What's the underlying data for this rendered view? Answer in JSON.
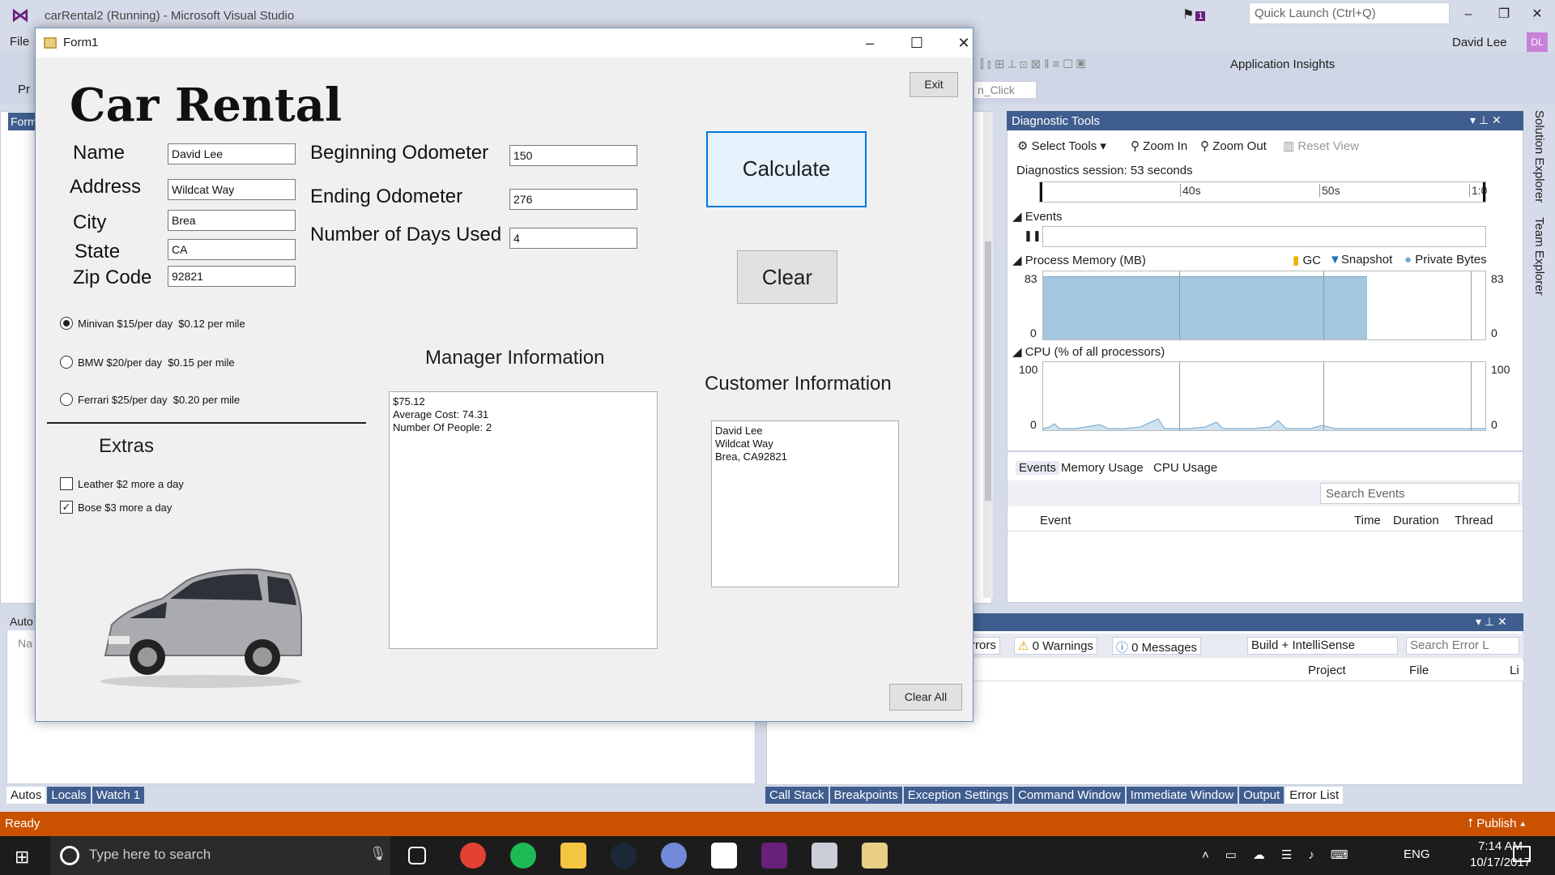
{
  "vs": {
    "title": "carRental2 (Running) - Microsoft Visual Studio",
    "quick_launch_placeholder": "Quick Launch (Ctrl+Q)",
    "user": "David Lee",
    "user_initials": "DL",
    "notification_count": "1",
    "menu_file": "File",
    "application_insights": "Application Insights",
    "handler_combo": "n_Click",
    "editor_tab": "Form",
    "autos_header": "Auto",
    "autos_col": "Na",
    "partial_toolbar_label": "Pr"
  },
  "bottom_left_tabs": [
    "Autos",
    "Locals",
    "Watch 1"
  ],
  "bottom_right_tabs": [
    "Call Stack",
    "Breakpoints",
    "Exception Settings",
    "Command Window",
    "Immediate Window",
    "Output",
    "Error List"
  ],
  "error_list": {
    "errors": "rrors",
    "warnings": "0 Warnings",
    "messages": "0 Messages",
    "build_filter": "Build + IntelliSense",
    "search_placeholder": "Search Error L",
    "columns": [
      "Project",
      "File",
      "Li"
    ]
  },
  "diagnostic_tools": {
    "title": "Diagnostic Tools",
    "select_tools": "Select Tools",
    "zoom_in": "Zoom In",
    "zoom_out": "Zoom Out",
    "reset_view": "Reset View",
    "session": "Diagnostics session: 53 seconds",
    "ticks": [
      "40s",
      "50s",
      "1:0"
    ],
    "events_label": "Events",
    "memory_label": "Process Memory (MB)",
    "legend_gc": "GC",
    "legend_snapshot": "Snapshot",
    "legend_private": "Private Bytes",
    "mem_max": "83",
    "mem_min": "0",
    "cpu_label": "CPU (% of all processors)",
    "cpu_max": "100",
    "cpu_min": "0",
    "tabs": [
      "Events",
      "Memory Usage",
      "CPU Usage"
    ],
    "search_placeholder": "Search Events",
    "columns": [
      "Event",
      "Time",
      "Duration",
      "Thread"
    ]
  },
  "side_tabs": [
    "Solution Explorer",
    "Team Explorer"
  ],
  "status": {
    "ready": "Ready",
    "publish": "Publish"
  },
  "taskbar": {
    "search_placeholder": "Type here to search",
    "lang": "ENG",
    "time": "7:14 AM",
    "date": "10/17/2017"
  },
  "form": {
    "title": "Form1",
    "heading": "Car Rental",
    "exit_label": "Exit",
    "name_label": "Name",
    "address_label": "Address",
    "city_label": "City",
    "state_label": "State",
    "zip_label": "Zip Code",
    "name_value": "David Lee",
    "address_value": "Wildcat Way",
    "city_value": "Brea",
    "state_value": "CA",
    "zip_value": "92821",
    "begin_odo_label": "Beginning Odometer",
    "end_odo_label": "Ending Odometer",
    "days_label": "Number of Days Used",
    "begin_odo_value": "150",
    "end_odo_value": "276",
    "days_value": "4",
    "calculate_label": "Calculate",
    "clear_label": "Clear",
    "clear_all_label": "Clear All",
    "vehicles": [
      {
        "label": "Minivan $15/per day  $0.12 per mile",
        "selected": true
      },
      {
        "label": "BMW $20/per day  $0.15 per mile",
        "selected": false
      },
      {
        "label": "Ferrari $25/per day  $0.20 per mile",
        "selected": false
      }
    ],
    "extras_label": "Extras",
    "extras": [
      {
        "label": "Leather $2 more a day",
        "checked": false
      },
      {
        "label": "Bose $3 more a day",
        "checked": true
      }
    ],
    "manager_label": "Manager Information",
    "manager_text": "$75.12\nAverage Cost: 74.31\nNumber Of People: 2",
    "customer_label": "Customer Information",
    "customer_text": "David Lee\nWildcat Way\nBrea, CA92821",
    "check_mark": "✓"
  },
  "colors": {
    "accent": "#3f5e8f",
    "status_bar": "#ca5100",
    "memory_fill": "#a3c7df",
    "vs_purple": "#68217a"
  }
}
